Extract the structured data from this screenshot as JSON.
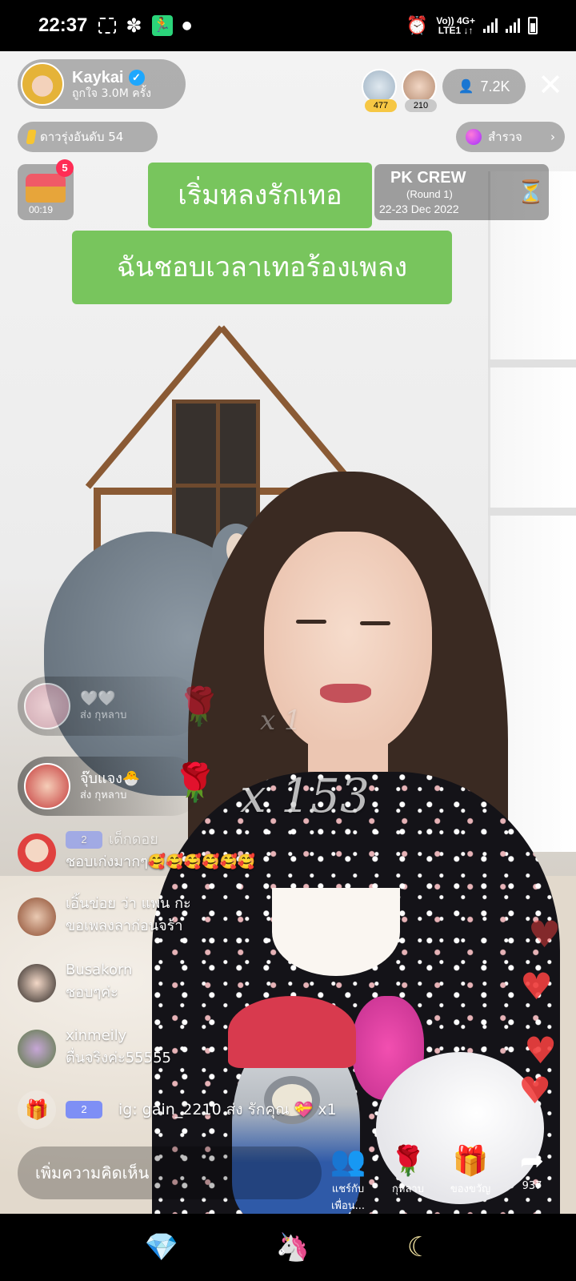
{
  "status_bar": {
    "time": "22:37",
    "network_top": "Vo)) 4G+",
    "network_bottom": "LTE1 ↓↑"
  },
  "host": {
    "name": "Kaykai",
    "likes": "ถูกใจ 3.0M ครั้ง"
  },
  "top_viewers": [
    {
      "badge": "477",
      "color": "#f6c744"
    },
    {
      "badge": "210",
      "color": "#c9c9c9"
    }
  ],
  "viewer_count": "7.2K",
  "rank_label": "ดาวรุ่งอันดับ 54",
  "explore_label": "สำรวจ",
  "treasure": {
    "badge": "5",
    "timer": "00:19"
  },
  "captions": {
    "line1": "เริ่มหลงรักเทอ",
    "line2": "ฉันชอบเวลาเทอร้องเพลง"
  },
  "pk": {
    "title": "PK CREW",
    "round": "(Round 1)",
    "dates": "22-23 Dec 2022"
  },
  "gift_banners": [
    {
      "name": "",
      "action": "ส่ง กุหลาบ",
      "multiplier": "x 1"
    },
    {
      "name": "จุ๊บแจง🐣",
      "action": "ส่ง กุหลาบ",
      "multiplier": "x 153"
    }
  ],
  "comments": [
    {
      "level": "2",
      "user": "เด็กดอย",
      "text": "ชอบเก่งมากๆ🥰🥰🥰🥰🥰🥰"
    },
    {
      "level": "",
      "user": "เอิ้นข่อย ว่า แพน กะ",
      "text": "ขอเพลงลาก่อนจร้า"
    },
    {
      "level": "",
      "user": "Busakorn",
      "text": "ชอบๆค่ะ"
    },
    {
      "level": "",
      "user": "xinmeily",
      "text": "ตื่นจริงค่ะ55555"
    }
  ],
  "gift_line": {
    "level": "2",
    "text": "ig: gain_2210 ส่ง รักคุณ 💝 x1"
  },
  "comment_placeholder": "เพิ่มความคิดเห็น",
  "actions": [
    {
      "icon": "share-users-icon",
      "label": "แชร์กับเพื่อน..."
    },
    {
      "icon": "rose-icon",
      "label": "กุหลาบ"
    },
    {
      "icon": "gift-icon",
      "label": "ของขวัญ"
    },
    {
      "icon": "share-arrow-icon",
      "label": "937"
    }
  ],
  "nav": [
    {
      "icon": "diamond-icon"
    },
    {
      "icon": "unicorn-icon"
    },
    {
      "icon": "moon-icon"
    }
  ],
  "colors": {
    "caption_bg": "#78c55d",
    "heart": "#f2403f",
    "level_badge": "#7e8ff5",
    "verified": "#1ea7fd"
  }
}
